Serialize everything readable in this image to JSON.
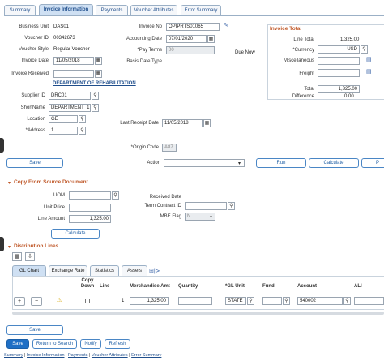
{
  "tabs": [
    "Summary",
    "Invoice Information",
    "Payments",
    "Voucher Attributes",
    "Error Summary"
  ],
  "header": {
    "business_unit_label": "Business Unit",
    "business_unit": "DAS01",
    "voucher_id_label": "Voucher ID",
    "voucher_id": "00342673",
    "voucher_style_label": "Voucher Style",
    "voucher_style": "Regular Voucher",
    "invoice_date_label": "Invoice Date",
    "invoice_date": "11/05/2018",
    "invoice_received_label": "Invoice Received",
    "invoice_no_label": "Invoice No",
    "invoice_no": "OPIPRTS01065",
    "accounting_date_label": "Accounting Date",
    "accounting_date": "07/01/2020",
    "pay_terms_label": "*Pay Terms",
    "pay_terms": "00",
    "due_now": "Due Now",
    "basis_date_label": "Basis Date Type",
    "supplier_name": "DEPARTMENT OF REHABILITATION",
    "supplier_id_label": "Supplier ID",
    "supplier_id": "DRC01",
    "short_name_label": "ShortName",
    "short_name": "DEPARTMENT_17",
    "location_label": "Location",
    "location": "GE",
    "address_label": "*Address",
    "address": "1",
    "last_receipt_label": "Last Receipt Date",
    "last_receipt": "11/05/2018",
    "origin_code_label": "*Origin Code",
    "origin_code": "A87"
  },
  "invoice_total": {
    "title": "Invoice Total",
    "line_total_label": "Line Total",
    "line_total": "1,325.00",
    "currency_label": "*Currency",
    "currency": "USD",
    "misc_label": "Miscellaneous",
    "freight_label": "Freight",
    "total_label": "Total",
    "total": "1,325.00",
    "difference_label": "Difference",
    "difference": "0.00"
  },
  "actions": {
    "save": "Save",
    "action_label": "Action",
    "run": "Run",
    "calculate": "Calculate",
    "extra": "P"
  },
  "copy_source": {
    "title": "Copy From Source Document",
    "uom_label": "UOM",
    "unit_price_label": "Unit Price",
    "line_amount_label": "Line Amount",
    "line_amount": "1,325.00",
    "received_date_label": "Received Date",
    "term_contract_label": "Term Contract ID",
    "mbe_label": "MBE Flag",
    "mbe": "N",
    "calculate": "Calculate"
  },
  "distribution": {
    "title": "Distribution Lines",
    "tabs": [
      "GL Chart",
      "Exchange Rate",
      "Statistics",
      "Assets"
    ],
    "columns": [
      "Copy Down",
      "Line",
      "Merchandise Amt",
      "Quantity",
      "*GL Unit",
      "Fund",
      "Account",
      "ALI"
    ],
    "row": {
      "line": "1",
      "amount": "1,325.00",
      "gl_unit": "STATE",
      "account": "540002"
    }
  },
  "footer": {
    "save": "Save",
    "buttons": [
      "Save",
      "Return to Search",
      "Notify",
      "Refresh"
    ],
    "links": [
      "Summary",
      "Invoice Information",
      "Payments",
      "Voucher Attributes",
      "Error Summary"
    ]
  },
  "colors": {
    "accent": "#1f6fc5",
    "section": "#c0592a",
    "tab_active": "#cfe0f3"
  }
}
